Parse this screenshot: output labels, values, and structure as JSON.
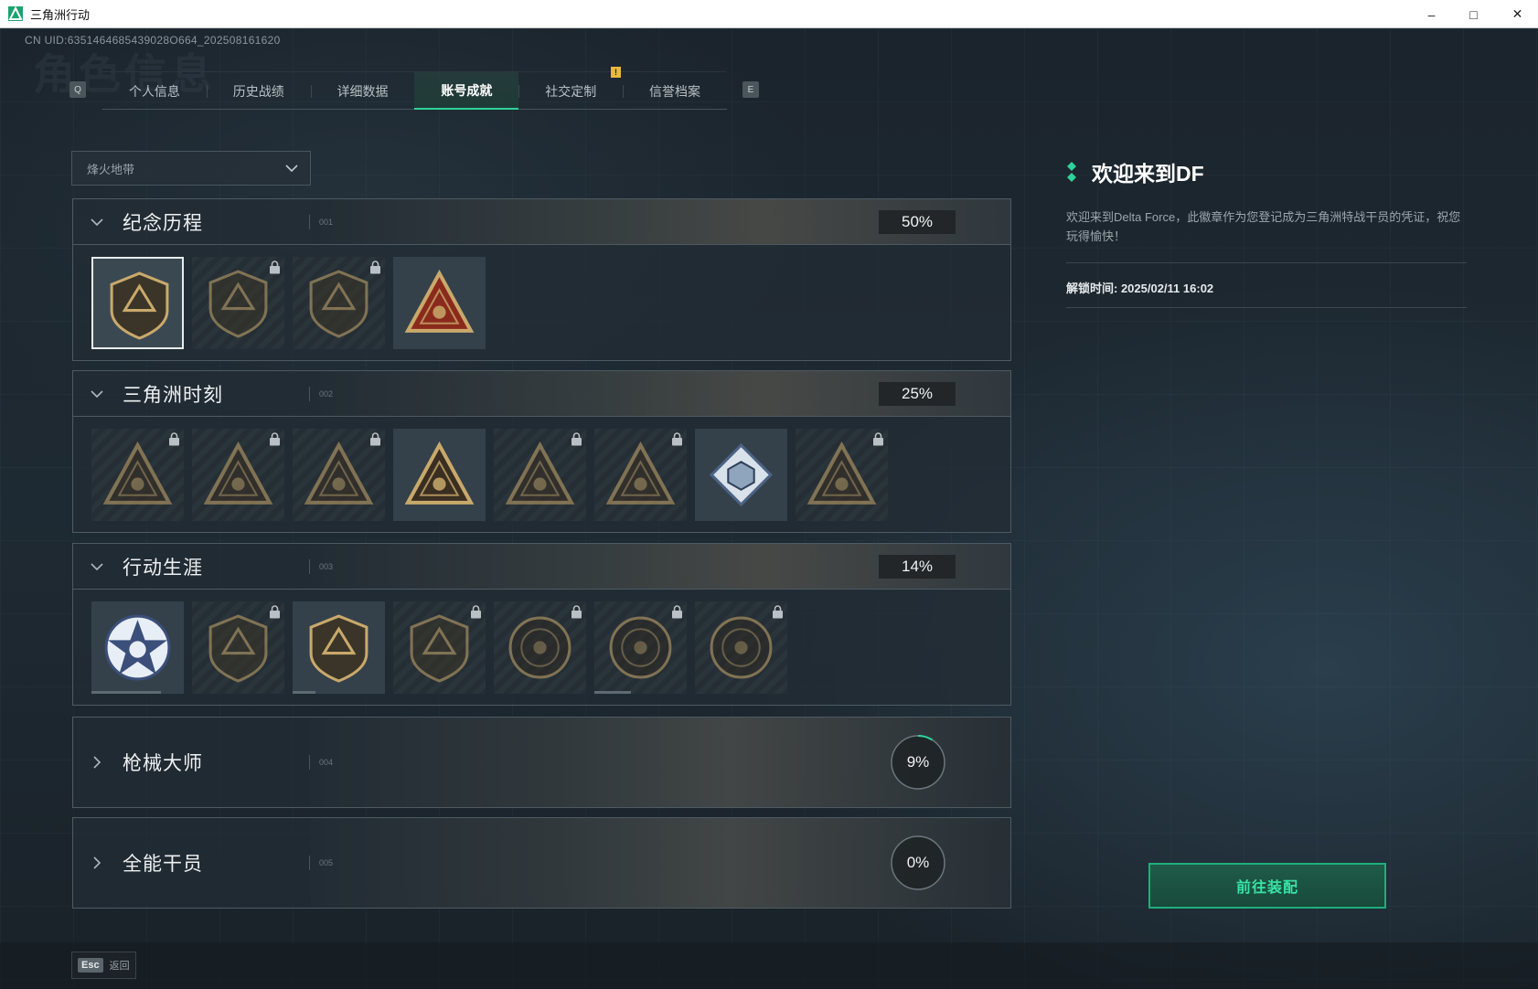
{
  "window": {
    "title": "三角洲行动",
    "minimize": "–",
    "maximize": "□",
    "close": "✕"
  },
  "uid": "CN UID:6351464685439028O664_202508161620",
  "watermark": "角色信息",
  "tabs": {
    "left_key": "Q",
    "right_key": "E",
    "notification": "!",
    "items": [
      {
        "label": "个人信息"
      },
      {
        "label": "历史战绩"
      },
      {
        "label": "详细数据"
      },
      {
        "label": "账号成就",
        "active": true
      },
      {
        "label": "社交定制"
      },
      {
        "label": "信誉档案"
      }
    ]
  },
  "mode_dropdown": {
    "value": "烽火地带"
  },
  "sections": [
    {
      "title": "纪念历程",
      "code": "001",
      "percent": "50%",
      "expanded": true,
      "badges": [
        {
          "icon": "delta-shield-icon",
          "locked": false,
          "selected": true
        },
        {
          "icon": "helicopter-badge-icon",
          "locked": true
        },
        {
          "icon": "hex-emblem-icon",
          "locked": true
        },
        {
          "icon": "rank-one-triangle-icon",
          "locked": false
        }
      ]
    },
    {
      "title": "三角洲时刻",
      "code": "002",
      "percent": "25%",
      "expanded": true,
      "badges": [
        {
          "icon": "robot-triangle-icon",
          "locked": true
        },
        {
          "icon": "operator-triangle-icon",
          "locked": true
        },
        {
          "icon": "hands-triangle-icon",
          "locked": true
        },
        {
          "icon": "squad-triangle-icon",
          "locked": false
        },
        {
          "icon": "beast-triangle-icon",
          "locked": true
        },
        {
          "icon": "dragon-triangle-icon",
          "locked": true
        },
        {
          "icon": "cube-diamond-icon",
          "locked": false
        },
        {
          "icon": "mask-triangle-icon",
          "locked": true
        }
      ]
    },
    {
      "title": "行动生涯",
      "code": "003",
      "percent": "14%",
      "expanded": true,
      "badges": [
        {
          "icon": "star-medal-icon",
          "locked": false,
          "progress": 0.75
        },
        {
          "icon": "chevron-shield-icon",
          "locked": true
        },
        {
          "icon": "arrow-shield-icon",
          "locked": false,
          "progress": 0.25
        },
        {
          "icon": "gem-shield-icon",
          "locked": true
        },
        {
          "icon": "ring-coin-icon",
          "locked": true
        },
        {
          "icon": "skull-coin-icon",
          "locked": true,
          "progress": 0.4
        },
        {
          "icon": "eye-coin-icon",
          "locked": true
        }
      ]
    },
    {
      "title": "枪械大师",
      "code": "004",
      "percent": "9%",
      "percent_value": 0.09,
      "expanded": false
    },
    {
      "title": "全能干员",
      "code": "005",
      "percent": "0%",
      "percent_value": 0,
      "expanded": false
    }
  ],
  "detail": {
    "title": "欢迎来到DF",
    "description": "欢迎来到Delta Force，此徽章作为您登记成为三角洲特战干员的凭证，祝您玩得愉快！",
    "unlock_time": "解锁时间: 2025/02/11 16:02"
  },
  "equip_button": "前往装配",
  "footer": {
    "esc_key": "Esc",
    "esc_label": "返回"
  },
  "colors": {
    "accent": "#2fd29a",
    "badge_gold": "#c9a96b",
    "notification": "#e8b83a"
  }
}
